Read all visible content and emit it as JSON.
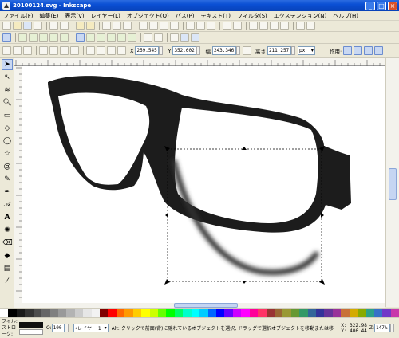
{
  "window": {
    "title": "20100124.svg - Inkscape",
    "min": "_",
    "max": "□",
    "close": "×"
  },
  "menu": [
    "ファイル(F)",
    "編集(E)",
    "表示(V)",
    "レイヤー(L)",
    "オブジェクト(O)",
    "パス(P)",
    "テキスト(T)",
    "フィルタ(S)",
    "エクステンション(N)",
    "ヘルプ(H)"
  ],
  "selectbar": {
    "x_label": "X",
    "x_value": "259.545",
    "y_label": "Y",
    "y_value": "352.602",
    "w_label": "幅",
    "w_value": "243.346",
    "h_label": "高さ",
    "h_value": "211.257",
    "unit": "px",
    "affect_label": "作用:"
  },
  "status": {
    "fill_label": "フィル:",
    "stroke_label": "ストローク:",
    "opacity_label": "O:",
    "opacity": "100",
    "layer": "•レイヤー 1",
    "message": "Alt: クリックで前面(背)に隠れているオブジェクトを選択, ドラッグで選択オブジェクトを移動または移",
    "coord_x": "X: 322.98",
    "coord_y": "Y: 406.44",
    "zoom_label": "Z:",
    "zoom": "147%"
  },
  "colors": {
    "glasses": "#1c1c1c",
    "selection_handle": "#000000",
    "titlebar": "#0a4fd4"
  },
  "icons": {
    "tools": [
      "selector-icon",
      "node-icon",
      "tweak-icon",
      "zoom-icon",
      "rectangle-icon",
      "3dbox-icon",
      "ellipse-icon",
      "star-icon",
      "spiral-icon",
      "pencil-icon",
      "pen-icon",
      "calligraphy-icon",
      "text-icon",
      "spray-icon",
      "eraser-icon",
      "bucket-icon",
      "gradient-icon",
      "dropper-icon"
    ]
  }
}
